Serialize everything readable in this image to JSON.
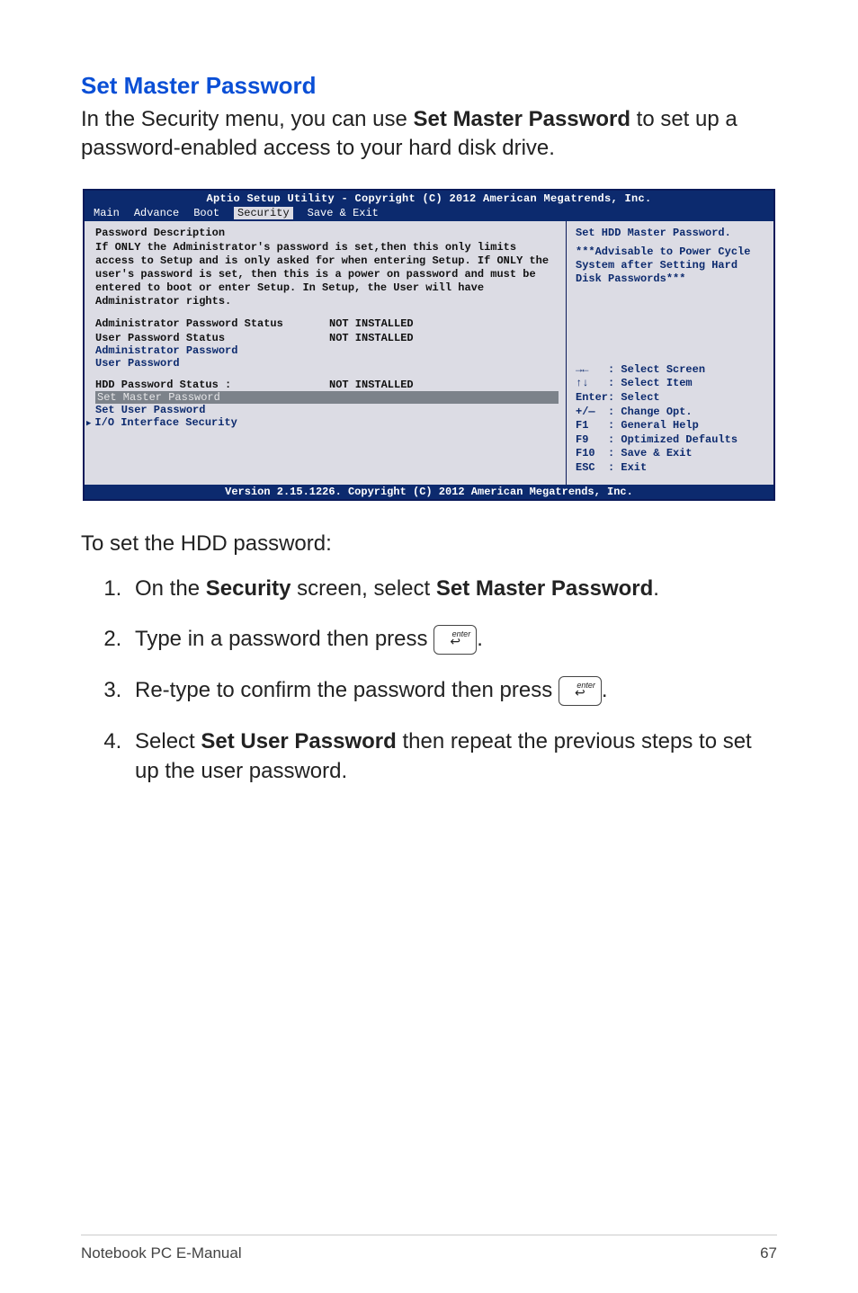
{
  "heading": "Set Master Password",
  "intro_before": "In the Security menu, you can use ",
  "intro_bold": "Set Master Password",
  "intro_after": " to set up a password-enabled access to your hard disk drive.",
  "bios": {
    "title": "Aptio Setup Utility - Copyright (C) 2012 American Megatrends, Inc.",
    "tabs": {
      "main": "Main",
      "advance": "Advance",
      "boot": "Boot",
      "security": "Security",
      "saveexit": "Save & Exit"
    },
    "left": {
      "hdr": "Password Description",
      "desc": "If ONLY the Administrator's password is set,then this only limits access to Setup and is only asked for when entering Setup. If ONLY the user's password is set, then this is a power on password and must be entered to boot or enter Setup. In Setup, the User will have Administrator rights.",
      "admin_status_label": "Administrator Password Status",
      "admin_status_value": "NOT INSTALLED",
      "user_status_label": "User Password Status",
      "user_status_value": "NOT INSTALLED",
      "admin_pw": "Administrator Password",
      "user_pw": "User Password",
      "hdd_status_label": "HDD Password Status :",
      "hdd_status_value": "NOT INSTALLED",
      "set_master": "Set Master Password",
      "set_user": "Set User Password",
      "io_sec": "I/O Interface Security"
    },
    "right": {
      "top1": "Set HDD Master Password.",
      "top2": "***Advisable to Power Cycle System after Setting Hard Disk Passwords***",
      "help": "→←   : Select Screen\n↑↓   : Select Item\nEnter: Select\n+/—  : Change Opt.\nF1   : General Help\nF9   : Optimized Defaults\nF10  : Save & Exit\nESC  : Exit"
    },
    "bottom": "Version 2.15.1226. Copyright (C) 2012 American Megatrends, Inc."
  },
  "subhead": "To set the HDD password:",
  "steps": {
    "s1_before": "On the ",
    "s1_b1": "Security",
    "s1_mid": " screen, select ",
    "s1_b2": "Set Master Password",
    "s1_after": ".",
    "s2_before": "Type in a password then press ",
    "s2_after": ".",
    "s3_before": "Re-type to confirm the password then press ",
    "s3_after": ".",
    "s4_before": "Select ",
    "s4_b1": "Set User Password",
    "s4_after": " then repeat the previous steps to set up the user password."
  },
  "key_label": "enter",
  "key_arrow": "↩",
  "footer_left": "Notebook PC E-Manual",
  "footer_right": "67",
  "chart_data": null
}
